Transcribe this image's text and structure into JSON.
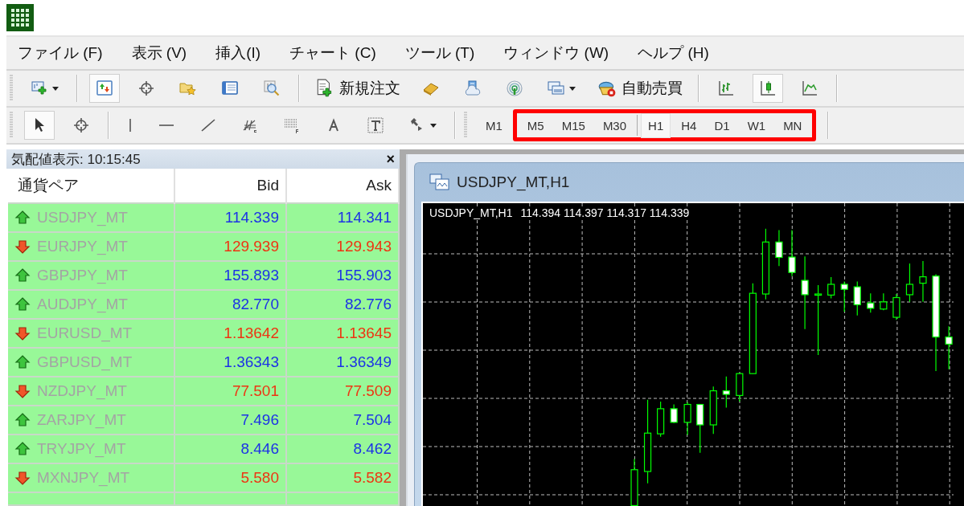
{
  "menu": [
    {
      "label": "ファイル (F)"
    },
    {
      "label": "表示 (V)"
    },
    {
      "label": "挿入(I)"
    },
    {
      "label": "チャート (C)"
    },
    {
      "label": "ツール (T)"
    },
    {
      "label": "ウィンドウ (W)"
    },
    {
      "label": "ヘルプ (H)"
    }
  ],
  "toolbar_main": [
    {
      "kind": "tool",
      "pressed": false,
      "dropdown": true
    },
    {
      "kind": "separator"
    },
    {
      "kind": "tool",
      "pressed": true,
      "dropdown": false
    },
    {
      "kind": "tool",
      "pressed": false,
      "dropdown": false
    },
    {
      "kind": "tool",
      "pressed": false,
      "dropdown": false
    },
    {
      "kind": "tool",
      "pressed": false,
      "dropdown": false
    },
    {
      "kind": "tool",
      "pressed": false,
      "dropdown": false
    },
    {
      "kind": "separator"
    },
    {
      "kind": "text",
      "label": "新規注文"
    },
    {
      "kind": "tool",
      "pressed": false,
      "dropdown": false
    },
    {
      "kind": "tool",
      "pressed": false,
      "dropdown": false
    },
    {
      "kind": "tool",
      "pressed": false,
      "dropdown": false
    },
    {
      "kind": "tool",
      "pressed": false,
      "dropdown": true
    },
    {
      "kind": "text",
      "label": "自動売買"
    },
    {
      "kind": "separator"
    },
    {
      "kind": "tool",
      "pressed": false,
      "dropdown": false
    },
    {
      "kind": "tool",
      "pressed": true,
      "dropdown": false
    },
    {
      "kind": "tool",
      "pressed": false,
      "dropdown": false
    },
    {
      "kind": "separator"
    }
  ],
  "toolbar_drawing": [
    {
      "kind": "tool",
      "pressed": true,
      "dropdown": false
    },
    {
      "kind": "tool",
      "pressed": false,
      "dropdown": false
    },
    {
      "kind": "separator"
    },
    {
      "kind": "tool",
      "pressed": false,
      "dropdown": false
    },
    {
      "kind": "tool",
      "pressed": false,
      "dropdown": false
    },
    {
      "kind": "tool",
      "pressed": false,
      "dropdown": false
    },
    {
      "kind": "tool",
      "pressed": false,
      "dropdown": false
    },
    {
      "kind": "tool",
      "pressed": false,
      "dropdown": false
    },
    {
      "kind": "tool",
      "pressed": false,
      "dropdown": false
    },
    {
      "kind": "tool",
      "pressed": false,
      "dropdown": false
    },
    {
      "kind": "tool",
      "pressed": false,
      "dropdown": true
    },
    {
      "kind": "separator"
    }
  ],
  "timeframes": [
    {
      "label": "M1",
      "selected": false,
      "highlighted": false
    },
    {
      "label": "M5",
      "selected": false,
      "highlighted": true
    },
    {
      "label": "M15",
      "selected": false,
      "highlighted": true
    },
    {
      "label": "M30",
      "selected": false,
      "highlighted": true
    },
    {
      "label": "H1",
      "selected": true,
      "highlighted": true
    },
    {
      "label": "H4",
      "selected": false,
      "highlighted": true
    },
    {
      "label": "D1",
      "selected": false,
      "highlighted": true
    },
    {
      "label": "W1",
      "selected": false,
      "highlighted": true
    },
    {
      "label": "MN",
      "selected": false,
      "highlighted": true
    }
  ],
  "market_watch": {
    "title": "気配値表示: 10:15:45",
    "close": "×",
    "columns": [
      "通貨ペア",
      "Bid",
      "Ask"
    ],
    "rows": [
      {
        "symbol": "USDJPY_MT",
        "rising": true,
        "bid": "114.339",
        "ask": "114.341"
      },
      {
        "symbol": "EURJPY_MT",
        "rising": false,
        "bid": "129.939",
        "ask": "129.943"
      },
      {
        "symbol": "GBPJPY_MT",
        "rising": true,
        "bid": "155.893",
        "ask": "155.903"
      },
      {
        "symbol": "AUDJPY_MT",
        "rising": true,
        "bid": "82.770",
        "ask": "82.776"
      },
      {
        "symbol": "EURUSD_MT",
        "rising": false,
        "bid": "1.13642",
        "ask": "1.13645"
      },
      {
        "symbol": "GBPUSD_MT",
        "rising": true,
        "bid": "1.36343",
        "ask": "1.36349"
      },
      {
        "symbol": "NZDJPY_MT",
        "rising": false,
        "bid": "77.501",
        "ask": "77.509"
      },
      {
        "symbol": "ZARJPY_MT",
        "rising": true,
        "bid": "7.496",
        "ask": "7.504"
      },
      {
        "symbol": "TRYJPY_MT",
        "rising": true,
        "bid": "8.446",
        "ask": "8.462"
      },
      {
        "symbol": "MXNJPY_MT",
        "rising": false,
        "bid": "5.580",
        "ask": "5.582"
      }
    ]
  },
  "chart_window": {
    "title": "USDJPY_MT,H1",
    "symbol_period": "USDJPY_MT,H1",
    "ohlc": "114.394 114.397 114.317 114.339"
  }
}
